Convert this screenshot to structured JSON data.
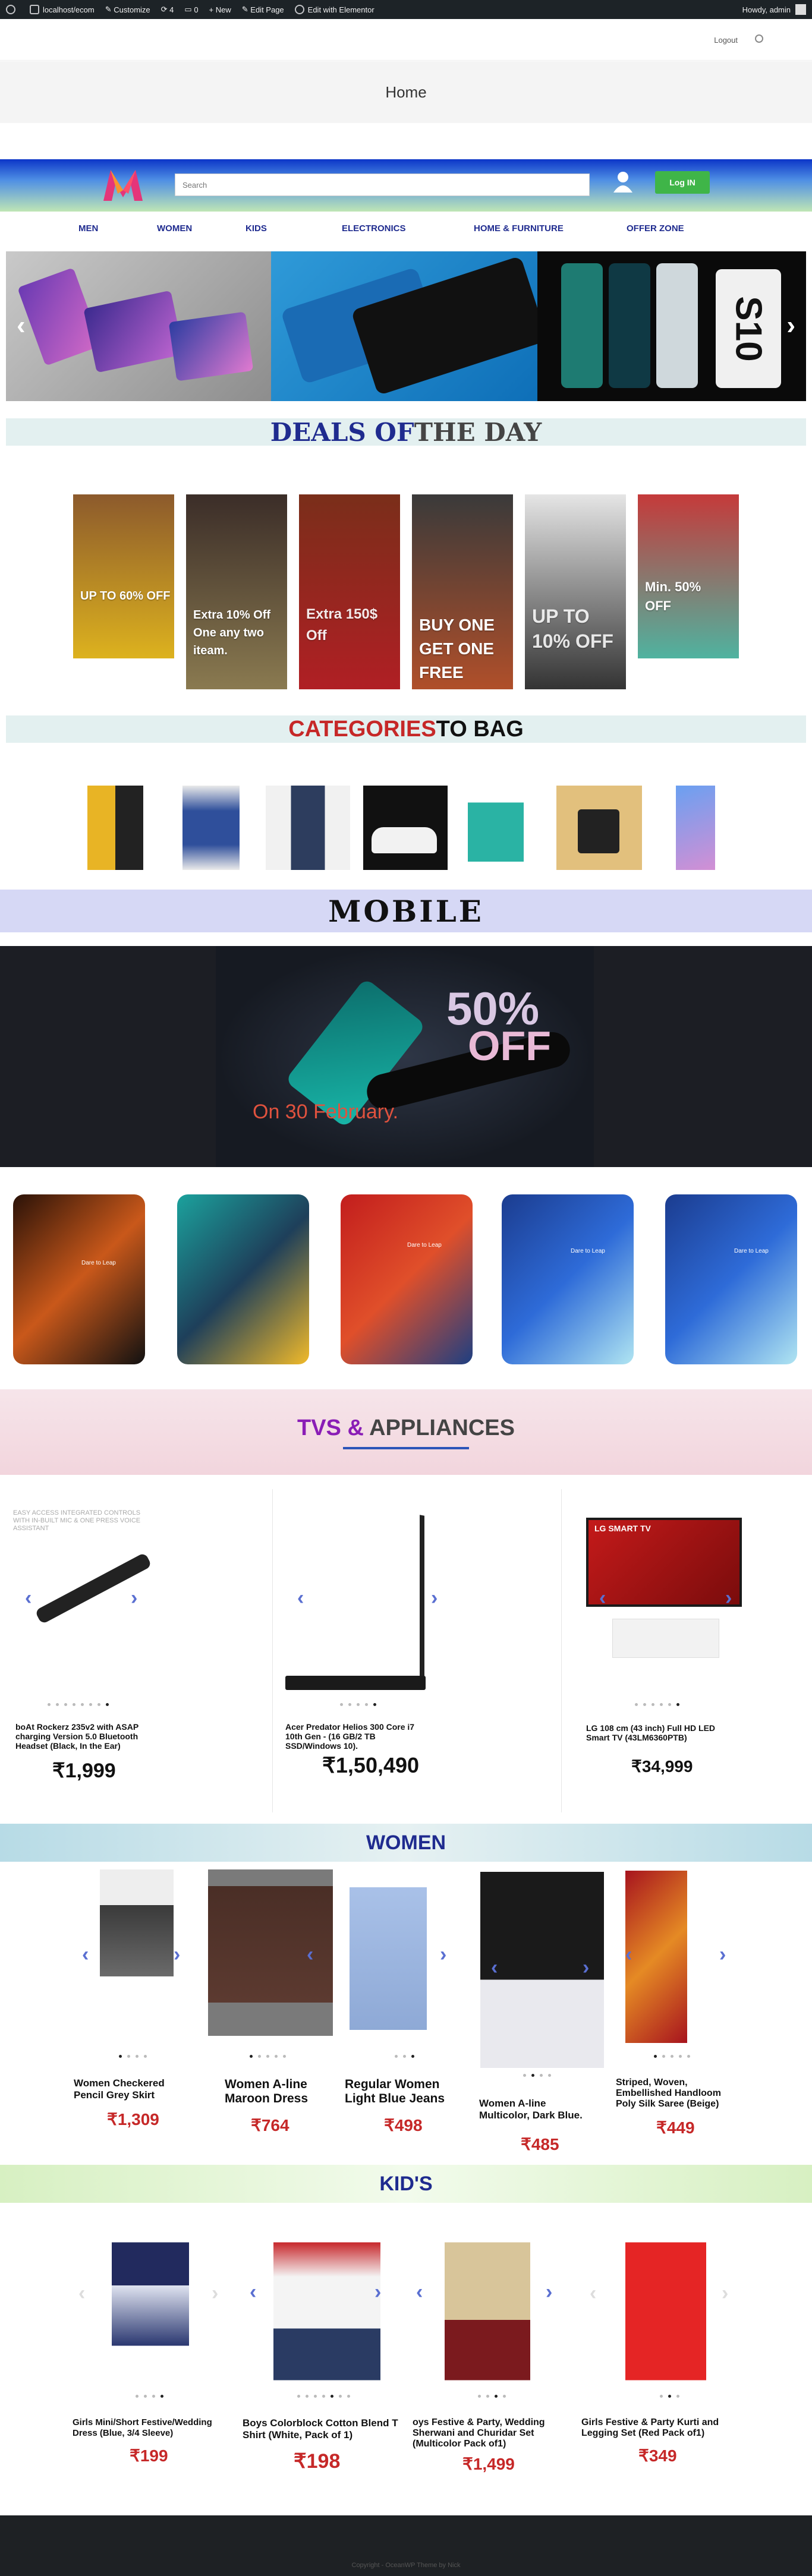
{
  "adminbar": {
    "site": "localhost/ecom",
    "customize": "Customize",
    "updates": "4",
    "comments": "0",
    "new": "+ New",
    "edit_page": "Edit Page",
    "elementor": "Edit with Elementor",
    "howdy": "Howdy, admin"
  },
  "topbar": {
    "logout": "Logout"
  },
  "page_title": "Home",
  "header": {
    "search_placeholder": "Search",
    "login": "Log IN"
  },
  "nav": [
    "MEN",
    "WOMEN",
    "KIDS",
    "ELECTRONICS",
    "HOME & FURNITURE",
    "OFFER ZONE"
  ],
  "slider": {
    "prev": "‹",
    "next": "›",
    "slide3_text": "S10"
  },
  "deals": {
    "title_a": "DEALS OF",
    "title_b": " THE DAY",
    "items": [
      "UP TO 60% OFF",
      "Extra 10% Off One any two iteam.",
      "Extra 150$ Off",
      "BUY ONE GET ONE FREE",
      "UP TO 10% OFF",
      "Min. 50% OFF"
    ]
  },
  "categories": {
    "title_a": "CATEGORIES",
    "title_b": " TO BAG"
  },
  "mobile": {
    "title": "MOBILE",
    "promo_pct": "50%",
    "promo_off": "OFF",
    "promo_date": "On 30 February.",
    "phone_labels": [
      "Dare to Leap",
      "",
      "Dare to Leap",
      "Dare to Leap",
      "Dare to Leap"
    ]
  },
  "tvs": {
    "title_a": "TVS & ",
    "title_b": "APPLIANCES",
    "products": [
      {
        "title": "boAt Rockerz 235v2 with ASAP charging Version 5.0 Bluetooth Headset (Black, In the Ear)",
        "price": "₹1,999",
        "img_text": "EASY ACCESS INTEGRATED CONTROLS WITH IN-BUILT MIC & ONE PRESS VOICE ASSISTANT"
      },
      {
        "title": "Acer Predator Helios 300 Core i7 10th Gen - (16 GB/2 TB SSD/Windows 10).",
        "price": "₹1,50,490",
        "img_text": ""
      },
      {
        "title": "LG 108 cm (43 inch) Full HD LED Smart TV (43LM6360PTB)",
        "price": "₹34,999",
        "img_text": "LG SMART TV"
      }
    ]
  },
  "women": {
    "title": "WOMEN",
    "products": [
      {
        "title": "Women Checkered Pencil Grey Skirt",
        "price": "₹1,309"
      },
      {
        "title": "Women A-line Maroon Dress",
        "price": "₹764"
      },
      {
        "title": "Regular Women Light Blue Jeans",
        "price": "₹498"
      },
      {
        "title": "Women A-line Multicolor, Dark Blue.",
        "price": "₹485"
      },
      {
        "title": "Striped, Woven, Embellished Handloom Poly Silk Saree (Beige)",
        "price": "₹449"
      }
    ]
  },
  "kids": {
    "title": "KID'S",
    "products": [
      {
        "title": "Girls Mini/Short Festive/Wedding Dress (Blue, 3/4 Sleeve)",
        "price": "₹199"
      },
      {
        "title": "Boys Colorblock Cotton Blend T Shirt (White, Pack of 1)",
        "price": "₹198"
      },
      {
        "title": "oys Festive & Party, Wedding Sherwani and Churidar Set (Multicolor Pack of1)",
        "price": "₹1,499"
      },
      {
        "title": "Girls Festive & Party Kurti and Legging Set (Red Pack of1)",
        "price": "₹349"
      }
    ]
  },
  "footer": {
    "text": "Copyright - OceanWP Theme by Nick"
  },
  "colors": {
    "brand_blue": "#1f2b8f",
    "login_green": "#3fb548",
    "price_red": "#c62828"
  }
}
